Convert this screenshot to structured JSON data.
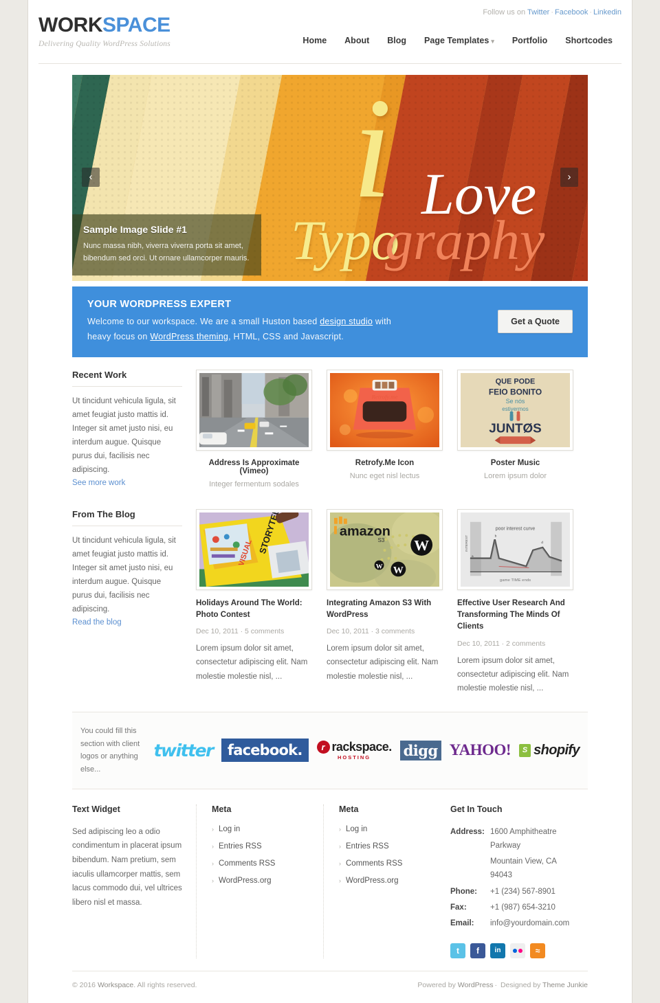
{
  "header": {
    "logo_dark": "WORK",
    "logo_blue": "SPACE",
    "tagline": "Delivering Quality WordPress Solutions",
    "follow_label": "Follow us on",
    "social_links": [
      "Twitter",
      "Facebook",
      "Linkedin"
    ],
    "nav": [
      {
        "label": "Home",
        "has_caret": false
      },
      {
        "label": "About",
        "has_caret": false
      },
      {
        "label": "Blog",
        "has_caret": false
      },
      {
        "label": "Page Templates",
        "has_caret": true
      },
      {
        "label": "Portfolio",
        "has_caret": false
      },
      {
        "label": "Shortcodes",
        "has_caret": false
      }
    ]
  },
  "slider": {
    "art_i": "i",
    "art_love": "Love",
    "art_typo": "Typo",
    "art_graphy": "graphy",
    "caption_title": "Sample Image Slide #1",
    "caption_text": "Nunc massa nibh, viverra viverra porta sit amet, bibendum sed orci. Ut ornare ullamcorper mauris.",
    "prev": "‹",
    "next": "›"
  },
  "callout": {
    "title": "YOUR WORDPRESS EXPERT",
    "line1_a": "Welcome to our workspace. We are a small Huston based ",
    "line1_link": "design studio",
    "line1_b": " with",
    "line2_a": "heavy focus on ",
    "line2_link": "WordPress theming",
    "line2_b": ", HTML, CSS and Javascript.",
    "button": "Get a Quote"
  },
  "recent_work": {
    "heading": "Recent Work",
    "text": "Ut tincidunt vehicula ligula, sit amet feugiat justo mattis id. Integer sit amet justo nisi, eu interdum augue. Quisque purus dui, facilisis nec adipiscing.",
    "link": "See more work",
    "items": [
      {
        "title": "Address Is Approximate (Vimeo)",
        "subtitle": "Integer fermentum sodales",
        "thumb": "city-street-photo"
      },
      {
        "title": "Retrofy.Me Icon",
        "subtitle": "Nunc eget nisl lectus",
        "thumb": "retrofy-icon"
      },
      {
        "title": "Poster Music",
        "subtitle": "Lorem ipsum dolor",
        "thumb": "juntos-poster"
      }
    ]
  },
  "from_blog": {
    "heading": "From The Blog",
    "text": "Ut tincidunt vehicula ligula, sit amet feugiat justo mattis id. Integer sit amet justo nisi, eu interdum augue. Quisque purus dui, facilisis nec adipiscing.",
    "link": "Read the blog",
    "posts": [
      {
        "title": "Holidays Around The World: Photo Contest",
        "meta": "Dec 10, 2011 · 5 comments",
        "excerpt": "Lorem ipsum dolor sit amet, consectetur adipiscing elit. Nam molestie molestie nisl, ...",
        "thumb": "visual-storytelling-book"
      },
      {
        "title": "Integrating Amazon S3 With WordPress",
        "meta": "Dec 10, 2011 · 3 comments",
        "excerpt": "Lorem ipsum dolor sit amet, consectetur adipiscing elit. Nam molestie molestie nisl, ...",
        "thumb": "amazon-s3-wordpress"
      },
      {
        "title": "Effective User Research And Transforming The Minds Of Clients",
        "meta": "Dec 10, 2011 · 2 comments",
        "excerpt": "Lorem ipsum dolor sit amet, consectetur adipiscing elit. Nam molestie molestie nisl, ...",
        "thumb": "poor-interest-curve-chart"
      }
    ]
  },
  "clients": {
    "note": "You could fill this section with client logos or anything else...",
    "logos": [
      "twitter",
      "facebook",
      "rackspace",
      "digg",
      "yahoo",
      "shopify"
    ],
    "rackspace_name": "rackspace.",
    "rackspace_sub": "HOSTING",
    "twitter_name": "twitter",
    "facebook_name": "facebook.",
    "digg_name": "digg",
    "yahoo_name": "YAHOO!",
    "shopify_name": "shopify",
    "shopify_mark": "S"
  },
  "footer": {
    "text_widget": {
      "heading": "Text Widget",
      "body": "Sed adipiscing leo a odio condimentum in placerat ipsum bibendum. Nam pretium, sem iaculis ullamcorper mattis, sem lacus commodo dui, vel ultrices libero nisl et massa."
    },
    "meta1": {
      "heading": "Meta",
      "items": [
        "Log in",
        "Entries RSS",
        "Comments RSS",
        "WordPress.org"
      ]
    },
    "meta2": {
      "heading": "Meta",
      "items": [
        "Log in",
        "Entries RSS",
        "Comments RSS",
        "WordPress.org"
      ]
    },
    "contact": {
      "heading": "Get In Touch",
      "address_label": "Address:",
      "address_line1": "1600 Amphitheatre Parkway",
      "address_line2": "Mountain View, CA 94043",
      "phone_label": "Phone:",
      "phone": "+1 (234) 567-8901",
      "fax_label": "Fax:",
      "fax": "+1 (987) 654-3210",
      "email_label": "Email:",
      "email": "info@yourdomain.com",
      "social": [
        "twitter",
        "facebook",
        "linkedin",
        "flickr",
        "rss"
      ]
    },
    "bottom": {
      "copyright_a": "© 2016 ",
      "copyright_site": "Workspace",
      "copyright_b": ". All rights reserved.",
      "powered_a": "Powered by ",
      "powered_link": "WordPress",
      "powered_sep": "·",
      "designed_a": " Designed by ",
      "designed_link": "Theme Junkie"
    }
  },
  "colors": {
    "accent_blue": "#3f8fdc",
    "logo_blue": "#4a90d9",
    "link_blue": "#5b8fd0",
    "page_bg": "#eceae5"
  }
}
